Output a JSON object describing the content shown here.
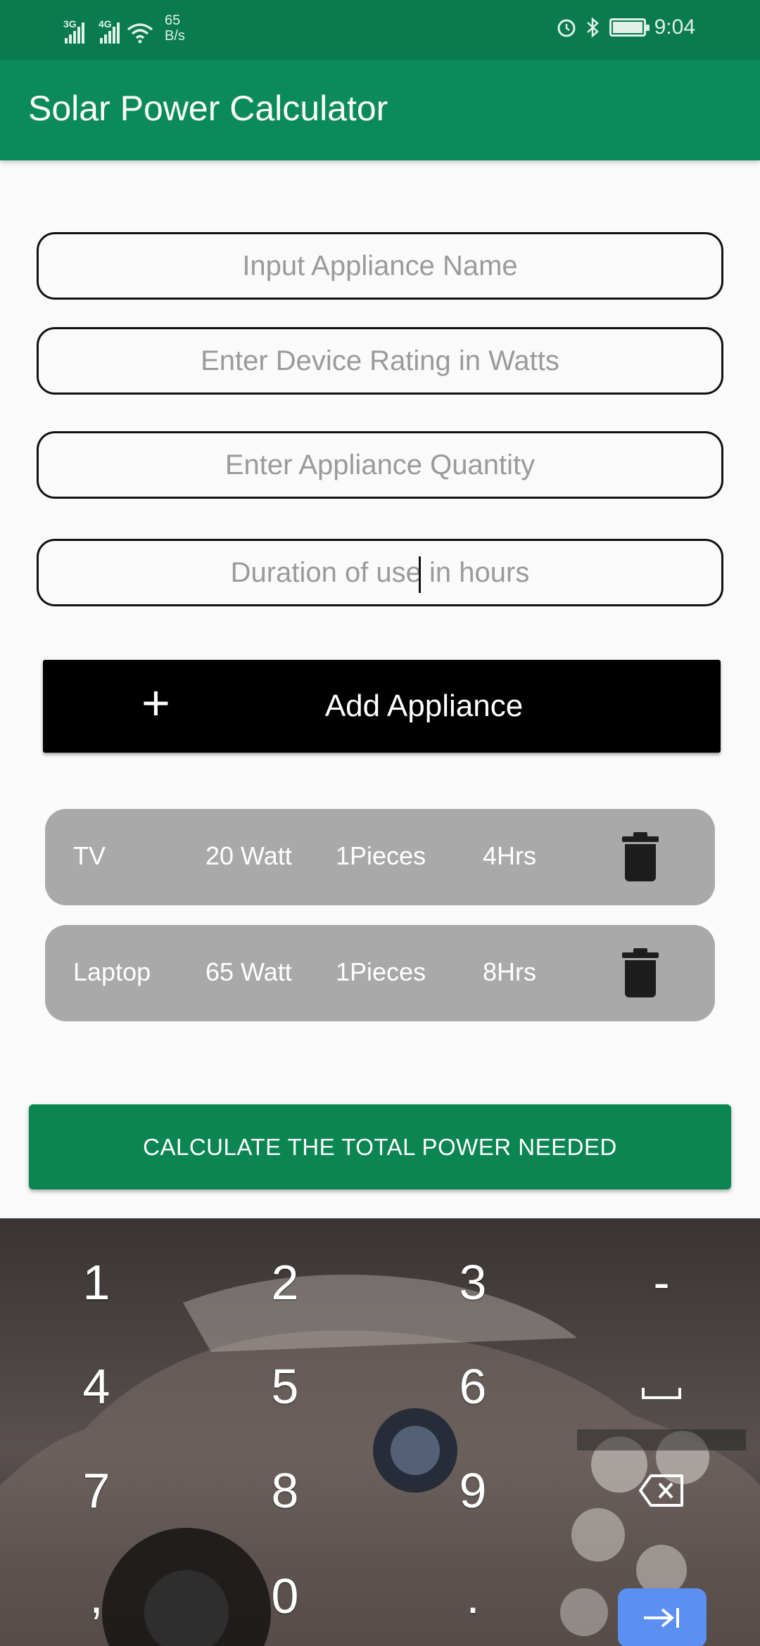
{
  "status_bar": {
    "sim1_label": "3G",
    "sim2_label": "4G",
    "speed_value": "65",
    "speed_unit": "B/s",
    "time": "9:04"
  },
  "app_bar": {
    "title": "Solar Power Calculator",
    "color": "#0b8b5b"
  },
  "form": {
    "appliance_name": {
      "placeholder": "Input Appliance Name",
      "value": ""
    },
    "device_rating": {
      "placeholder": "Enter Device Rating in Watts",
      "value": ""
    },
    "quantity": {
      "placeholder": "Enter Appliance Quantity",
      "value": ""
    },
    "duration": {
      "placeholder": "Duration of use in hours",
      "value": ""
    }
  },
  "add_button": {
    "icon": "plus-icon",
    "label": "Add Appliance"
  },
  "appliances": [
    {
      "name": "TV",
      "rating": "20 Watt",
      "quantity": "1Pieces",
      "hours": "4Hrs",
      "delete_icon": "trash-icon"
    },
    {
      "name": "Laptop",
      "rating": "65 Watt",
      "quantity": "1Pieces",
      "hours": "8Hrs",
      "delete_icon": "trash-icon"
    }
  ],
  "calculate_button": {
    "label": "CALCULATE THE TOTAL POWER NEEDED",
    "color": "#0b8653"
  },
  "keyboard": {
    "keys": [
      [
        "1",
        "2",
        "3",
        "-"
      ],
      [
        "4",
        "5",
        "6",
        "space"
      ],
      [
        "7",
        "8",
        "9",
        "backspace"
      ],
      [
        ",",
        "0",
        ".",
        "enter"
      ]
    ],
    "enter_color": "#5b8ff2"
  }
}
